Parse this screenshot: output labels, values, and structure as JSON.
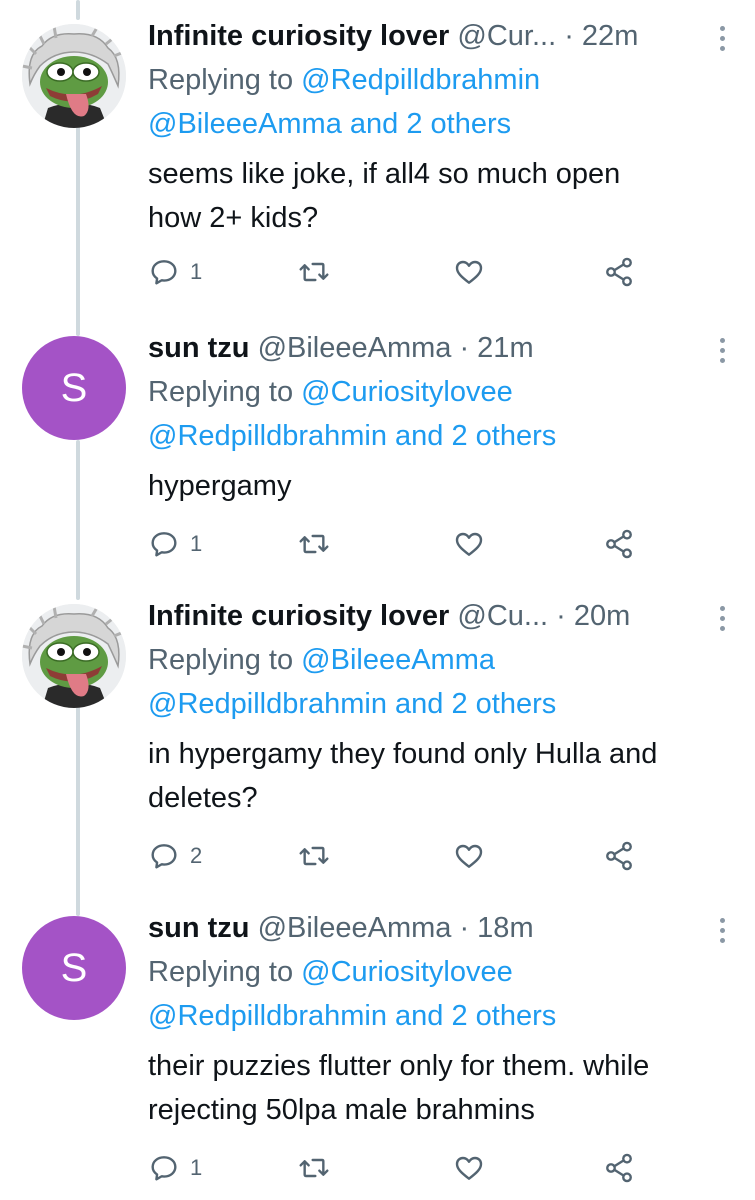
{
  "tweets": [
    {
      "name": "Infinite curiosity lover",
      "handle": "@Cur...",
      "time": "· 22m",
      "avatar": "pepe-einstein-avatar",
      "reply_prefix": "Replying to",
      "reply_first": "@Redpilldbrahmin",
      "reply_second": "@BileeeAmma and 2 others",
      "text_lines": [
        "seems like joke, if all4 so much open",
        "how 2+ kids?"
      ],
      "reply_count": "1"
    },
    {
      "name": "sun tzu",
      "handle": "@BileeeAmma",
      "time": "· 21m",
      "avatar_letter": "S",
      "reply_prefix": "Replying to",
      "reply_first": "@Curiositylovee",
      "reply_second": "@Redpilldbrahmin and 2 others",
      "text_lines": [
        "hypergamy"
      ],
      "reply_count": "1"
    },
    {
      "name": "Infinite curiosity lover",
      "handle": "@Cu...",
      "time": "· 20m",
      "avatar": "pepe-einstein-avatar",
      "reply_prefix": "Replying to",
      "reply_first": "@BileeeAmma",
      "reply_second": "@Redpilldbrahmin and 2 others",
      "text_lines": [
        "in hypergamy they found only Hulla and",
        "deletes?"
      ],
      "reply_count": "2"
    },
    {
      "name": "sun tzu",
      "handle": "@BileeeAmma",
      "time": "· 18m",
      "avatar_letter": "S",
      "reply_prefix": "Replying to",
      "reply_first": "@Curiositylovee",
      "reply_second": "@Redpilldbrahmin and 2 others",
      "text_lines": [
        "their puzzies flutter only for them. while",
        "rejecting 50lpa male brahmins"
      ],
      "reply_count": "1"
    }
  ],
  "icons": {
    "reply": "reply-icon",
    "retweet": "retweet-icon",
    "like": "heart-icon",
    "share": "share-icon",
    "more": "more-options-icon"
  },
  "colors": {
    "accent": "#1d9bf0",
    "secondary_text": "#536471",
    "thread_line": "#cfd9de",
    "avatar_letter_bg": "#a453c6"
  }
}
